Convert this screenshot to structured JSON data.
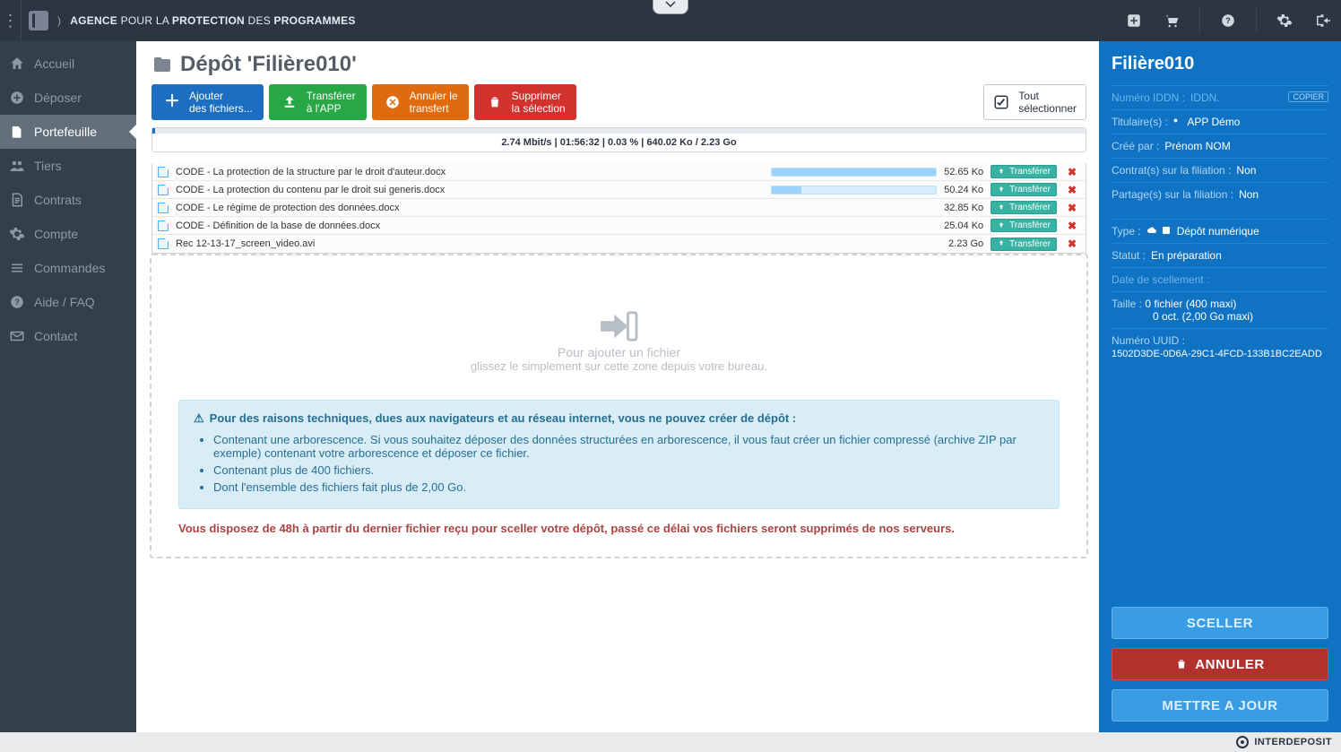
{
  "brand": {
    "word1": "AGENCE",
    "word2": "POUR LA",
    "word3": "PROTECTION",
    "word4": "DES",
    "word5": "PROGRAMMES"
  },
  "sidebar": {
    "items": [
      {
        "label": "Accueil"
      },
      {
        "label": "Déposer"
      },
      {
        "label": "Portefeuille"
      },
      {
        "label": "Tiers"
      },
      {
        "label": "Contrats"
      },
      {
        "label": "Compte"
      },
      {
        "label": "Commandes"
      },
      {
        "label": "Aide / FAQ"
      },
      {
        "label": "Contact"
      }
    ]
  },
  "page": {
    "title": "Dépôt 'Filière010'",
    "actions": {
      "add1": "Ajouter",
      "add2": "des fichiers...",
      "xfer1": "Transférer",
      "xfer2": "à l'APP",
      "cancel1": "Annuler le",
      "cancel2": "transfert",
      "del1": "Supprimer",
      "del2": "la sélection",
      "selectall1": "Tout",
      "selectall2": "sélectionner"
    },
    "progress": {
      "label": "2.74 Mbit/s | 01:56:32 | 0.03 % | 640.02 Ko / 2.23 Go"
    },
    "transfer_label": "Transférer",
    "files": [
      {
        "name": "CODE - La protection de la structure par le droit d'auteur.docx",
        "size": "52.65 Ko",
        "progress": true
      },
      {
        "name": "CODE - La protection du contenu par le droit sui generis.docx",
        "size": "50.24 Ko",
        "progress": true
      },
      {
        "name": "CODE - Le régime de protection des données.docx",
        "size": "32.85 Ko",
        "progress": false
      },
      {
        "name": "CODE - Définition de la base de données.docx",
        "size": "25.04 Ko",
        "progress": false
      },
      {
        "name": "Rec 12-13-17_screen_video.avi",
        "size": "2.23 Go",
        "progress": false
      }
    ],
    "dropzone": {
      "line1": "Pour ajouter un fichier",
      "line2": "glissez le simplement sur cette zone depuis votre bureau."
    },
    "alert": {
      "header": "Pour des raisons techniques, dues aux navigateurs et au réseau internet, vous ne pouvez créer de dépôt :",
      "bul1": "Contenant une arborescence. Si vous souhaitez déposer des données structurées en arborescence, il vous faut créer un fichier compressé (archive ZIP par exemple) contenant votre arborescence et déposer ce fichier.",
      "bul2": "Contenant plus de 400 fichiers.",
      "bul3": "Dont l'ensemble des fichiers fait plus de 2,00 Go."
    },
    "deadline": "Vous disposez de 48h à partir du dernier fichier reçu pour sceller votre dépôt, passé ce délai vos fichiers seront supprimés de nos serveurs."
  },
  "rpanel": {
    "title": "Filière010",
    "copier": "COPIER",
    "iddn_lbl": "Numéro IDDN :",
    "iddn_val": "IDDN.",
    "titulaire_lbl": "Titulaire(s) :",
    "titulaire_val": "APP Démo",
    "cree_lbl": "Créé par :",
    "cree_val": "Prénom NOM",
    "contrat_lbl": "Contrat(s) sur la filiation :",
    "contrat_val": "Non",
    "partage_lbl": "Partage(s) sur la filiation :",
    "partage_val": "Non",
    "type_lbl": "Type :",
    "type_val": "Dépôt numérique",
    "statut_lbl": "Statut :",
    "statut_val": "En préparation",
    "scel_lbl": "Date de scellement :",
    "taille_lbl": "Taille :",
    "taille_val1": "0 fichier (400 maxi)",
    "taille_val2": "0 oct. (2,00 Go maxi)",
    "uuid_lbl": "Numéro UUID :",
    "uuid_val": "1502D3DE-0D6A-29C1-4FCD-133B1BC2EADD",
    "btn_seal": "SCELLER",
    "btn_cancel": "ANNULER",
    "btn_update": "METTRE A JOUR"
  },
  "footer": {
    "text": "INTERDEPOSIT"
  }
}
